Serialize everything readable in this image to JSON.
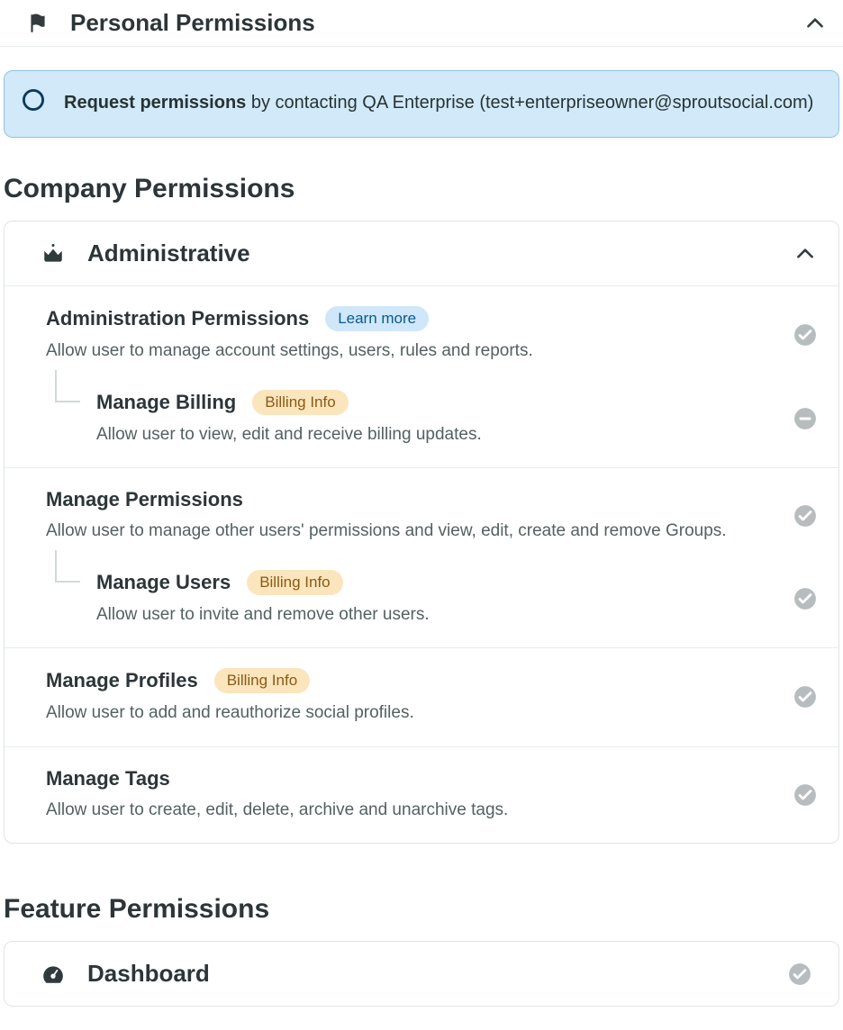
{
  "personal": {
    "title": "Personal Permissions"
  },
  "banner": {
    "bold": "Request permissions",
    "rest": " by contacting QA Enterprise (test+enterpriseowner@sproutsocial.com)"
  },
  "company": {
    "title": "Company Permissions",
    "card": {
      "title": "Administrative",
      "rows": [
        {
          "title": "Administration Permissions",
          "pill_label": "Learn more",
          "pill_class": "blue",
          "desc": "Allow user to manage account settings, users, rules and reports.",
          "status": "check",
          "sub": {
            "title": "Manage Billing",
            "pill_label": "Billing Info",
            "pill_class": "amber",
            "desc": "Allow user to view, edit and receive billing updates.",
            "status": "minus"
          }
        },
        {
          "title": "Manage Permissions",
          "desc": "Allow user to manage other users' permissions and view, edit, create and remove Groups.",
          "status": "check",
          "sub": {
            "title": "Manage Users",
            "pill_label": "Billing Info",
            "pill_class": "amber",
            "desc": "Allow user to invite and remove other users.",
            "status": "check"
          }
        },
        {
          "title": "Manage Profiles",
          "pill_label": "Billing Info",
          "pill_class": "amber",
          "desc": "Allow user to add and reauthorize social profiles.",
          "status": "check"
        },
        {
          "title": "Manage Tags",
          "desc": "Allow user to create, edit, delete, archive and unarchive tags.",
          "status": "check"
        }
      ]
    }
  },
  "feature": {
    "title": "Feature Permissions",
    "card": {
      "title": "Dashboard",
      "status": "check"
    }
  }
}
